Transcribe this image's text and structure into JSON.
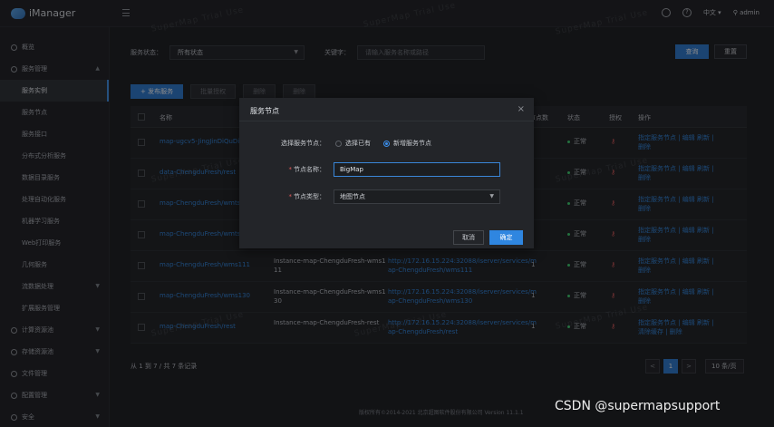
{
  "app": {
    "name": "iManager"
  },
  "header": {
    "lang": "中文",
    "user": "admin"
  },
  "sidebar": {
    "items": [
      {
        "label": "概览",
        "level": 0,
        "icon": "dashboard-icon",
        "caret": ""
      },
      {
        "label": "服务管理",
        "level": 0,
        "icon": "service-icon",
        "caret": "^"
      },
      {
        "label": "服务实例",
        "level": 1,
        "active": true
      },
      {
        "label": "服务节点",
        "level": 1
      },
      {
        "label": "服务接口",
        "level": 1
      },
      {
        "label": "分布式分析服务",
        "level": 1
      },
      {
        "label": "数据目录服务",
        "level": 1
      },
      {
        "label": "处理自动化服务",
        "level": 1
      },
      {
        "label": "机器学习服务",
        "level": 1
      },
      {
        "label": "Web打印服务",
        "level": 1
      },
      {
        "label": "几何服务",
        "level": 1
      },
      {
        "label": "流数据处理",
        "level": 1,
        "caret": "v"
      },
      {
        "label": "扩展服务管理",
        "level": 1
      },
      {
        "label": "计算资源池",
        "level": 0,
        "icon": "compute-icon",
        "caret": "v"
      },
      {
        "label": "存储资源池",
        "level": 0,
        "icon": "storage-icon",
        "caret": "v"
      },
      {
        "label": "文件管理",
        "level": 0,
        "icon": "folder-icon",
        "caret": ""
      },
      {
        "label": "配置管理",
        "level": 0,
        "icon": "config-icon",
        "caret": "v"
      },
      {
        "label": "安全",
        "level": 0,
        "icon": "security-icon",
        "caret": "v"
      }
    ]
  },
  "filter": {
    "status_label": "服务状态：",
    "status_value": "所有状态",
    "keyword_label": "关键字：",
    "keyword_placeholder": "请输入服务名称或路径",
    "query_btn": "查询",
    "reset_btn": "重置"
  },
  "toolbar": {
    "publish": "+ 发布服务",
    "batch_auth": "批量授权",
    "delete1": "删除",
    "delete2": "删除"
  },
  "table": {
    "headers": {
      "name": "名称",
      "nodes": "节点数",
      "status": "状态",
      "auth": "授权",
      "ops": "操作"
    },
    "rows": [
      {
        "name": "map-ugcv5-JingJinDiQuDiTu",
        "name2": "",
        "instance": "",
        "url": "",
        "url2": "",
        "nodes": "",
        "status": "正常",
        "ops": "指定服务节点 | 编辑  刷新 |",
        "ops2": "删除"
      },
      {
        "name": "data-ChengduFresh/rest",
        "name2": "",
        "instance": "",
        "url": "",
        "url2": "",
        "nodes": "",
        "status": "正常",
        "ops": "指定服务节点 | 编辑  刷新 |",
        "ops2": "删除"
      },
      {
        "name": "map-ChengduFresh/wmts10",
        "name2": "",
        "instance": "",
        "url": "",
        "url2": "",
        "nodes": "",
        "status": "正常",
        "ops": "指定服务节点 | 编辑  刷新 |",
        "ops2": "删除"
      },
      {
        "name": "map-ChengduFresh/wmts-ch",
        "name2": "",
        "instance": "",
        "url": "",
        "url2": "",
        "nodes": "",
        "status": "正常",
        "ops": "指定服务节点 | 编辑  刷新 |",
        "ops2": "删除"
      },
      {
        "name": "map-ChengduFresh/wms111",
        "name2": "",
        "instance": "Instance-map-ChengduFresh-wms1",
        "instance2": "11",
        "url": "http://172.16.15.224:32088/iserver/services/m",
        "url2": "ap-ChengduFresh/wms111",
        "nodes": "1",
        "status": "正常",
        "ops": "指定服务节点 | 编辑  刷新 |",
        "ops2": "删除"
      },
      {
        "name": "map-ChengduFresh/wms130",
        "name2": "",
        "instance": "Instance-map-ChengduFresh-wms1",
        "instance2": "30",
        "url": "http://172.16.15.224:32088/iserver/services/m",
        "url2": "ap-ChengduFresh/wms130",
        "nodes": "1",
        "status": "正常",
        "ops": "指定服务节点 | 编辑  刷新 |",
        "ops2": "删除"
      },
      {
        "name": "map-ChengduFresh/rest",
        "name2": "",
        "instance": "Instance-map-ChengduFresh-rest",
        "instance2": "",
        "url": "http://172.16.15.224:32088/iserver/services/m",
        "url2": "ap-ChengduFresh/rest",
        "nodes": "1",
        "status": "正常",
        "ops": "指定服务节点 | 编辑  刷新 |",
        "ops2": "清除缓存 | 删除"
      }
    ]
  },
  "pagination": {
    "info": "从 1 到 7 / 共 7 条记录",
    "prev": "<",
    "current": "1",
    "next": ">",
    "page_size": "10 条/页"
  },
  "footer": {
    "text": "版权所有©2014-2021 北京超图软件股份有限公司    Version 11.1.1"
  },
  "modal": {
    "title": "服务节点",
    "close": "×",
    "select_label": "选择服务节点：",
    "radio_existing": "选择已有",
    "radio_new": "新增服务节点",
    "selected": "new",
    "node_name_label": "节点名称：",
    "node_name_value": "BigMap",
    "node_type_label": "节点类型：",
    "node_type_value": "地图节点",
    "cancel": "取消",
    "ok": "确定"
  },
  "watermark": {
    "text": "SuperMap Trial Use"
  },
  "credit": {
    "text": "CSDN @supermapsupport"
  },
  "colors": {
    "accent": "#2b79d0",
    "ok": "#3ccf6d",
    "danger": "#e45a5a",
    "bg": "#1a1b1e"
  }
}
